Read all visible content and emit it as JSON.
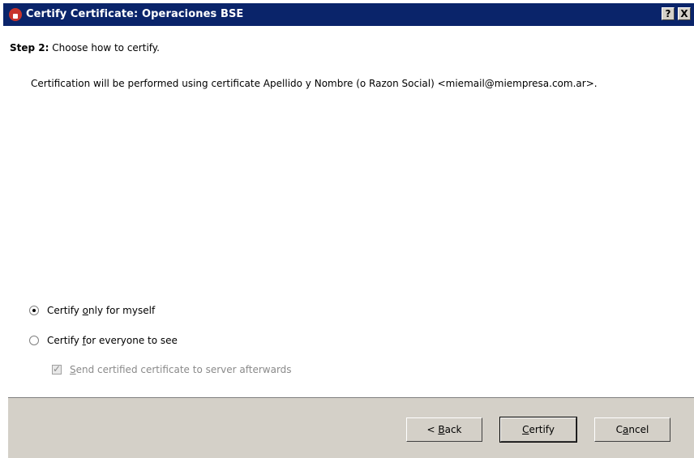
{
  "window": {
    "title": "Certify Certificate: Operaciones BSE",
    "help_button": "?",
    "close_button": "X"
  },
  "step": {
    "label": "Step 2:",
    "text": "Choose how to certify."
  },
  "info_text": "Certification will be performed using certificate Apellido y Nombre (o Razon Social) <miemail@miempresa.com.ar>.",
  "options": {
    "myself": {
      "pre": "Certify ",
      "accel": "o",
      "post": "nly for myself",
      "selected": true
    },
    "everyone": {
      "pre": "Certify ",
      "accel": "f",
      "post": "or everyone to see",
      "selected": false
    },
    "send_server": {
      "pre": "",
      "accel": "S",
      "post": "end certified certificate to server afterwards",
      "checked": true,
      "enabled": false
    }
  },
  "buttons": {
    "back": {
      "pre": "< ",
      "accel": "B",
      "post": "ack"
    },
    "certify": {
      "pre": "",
      "accel": "C",
      "post": "ertify"
    },
    "cancel": {
      "pre": "C",
      "accel": "a",
      "post": "ncel"
    }
  },
  "colors": {
    "titlebar": "#0a246a",
    "footer": "#d4d0c8",
    "disabled_text": "#8a8a8a"
  }
}
